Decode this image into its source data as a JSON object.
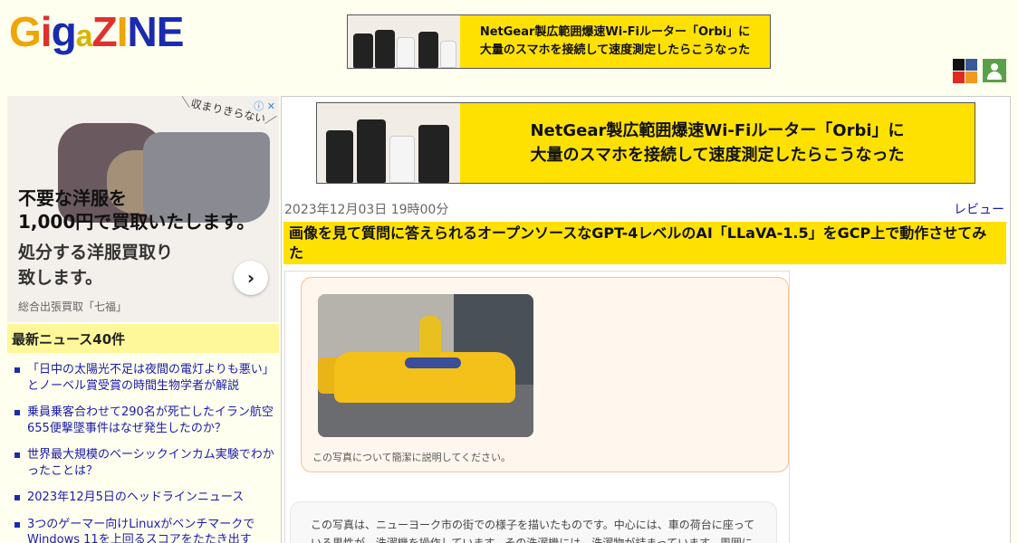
{
  "header": {
    "logo_parts": [
      "G",
      "i",
      "g",
      "a",
      "Z",
      "I",
      "N",
      "E"
    ],
    "top_banner": {
      "line1": "NetGear製広範囲爆速Wi-Fiルーター「Orbi」に",
      "line2": "大量のスマホを接続して速度測定したらこうなった"
    },
    "social_icons": [
      "x-icon",
      "facebook-icon",
      "youtube-icon",
      "rss-icon"
    ],
    "user_icon": "user-icon"
  },
  "sidebar": {
    "ad": {
      "tag": "＼収まりきらない／",
      "headline": "不要な洋服を1,000円で買取いたします。",
      "headline_line1": "不要な洋服を",
      "headline_line2": "1,000円で買取いたします。",
      "sub_line1": "処分する洋服買取り",
      "sub_line2": "致します。",
      "sponsor": "総合出張買取「七福」"
    },
    "news_heading": "最新ニュース40件",
    "news_items": [
      "「日中の太陽光不足は夜間の電灯よりも悪い」とノーベル賞受賞の時間生物学者が解説",
      "乗員乗客合わせて290名が死亡したイラン航空655便撃墜事件はなぜ発生したのか？",
      "世界最大規模のベーシックインカム実験でわかったことは？",
      "2023年12月5日のヘッドラインニュース",
      "3つのゲーマー向けLinuxがベンチマークでWindows 11を上回るスコアをたたき出す"
    ]
  },
  "main": {
    "banner": {
      "line1": "NetGear製広範囲爆速Wi-Fiルーター「Orbi」に",
      "line2": "大量のスマホを接続して速度測定したらこうなった"
    },
    "date": "2023年12月03日 19時00分",
    "category": "レビュー",
    "title": "画像を見て質問に答えられるオープンソースなGPT-4レベルのAI「LLaVA-1.5」をGCP上で動作させてみた",
    "figure": {
      "prompt": "この写真について簡潔に説明してください。",
      "answer": "この写真は、ニューヨーク市の街での様子を描いたものです。中心には、車の荷台に座っている男性が、洗濯機を操作しています。その洗濯機には、洗濯物が詰まっています。周囲には、タクシーが複数あ"
    }
  },
  "colors": {
    "banner_yellow": "#ffe100",
    "link_blue": "#1a1ab0",
    "page_bg": "#fffff0"
  }
}
